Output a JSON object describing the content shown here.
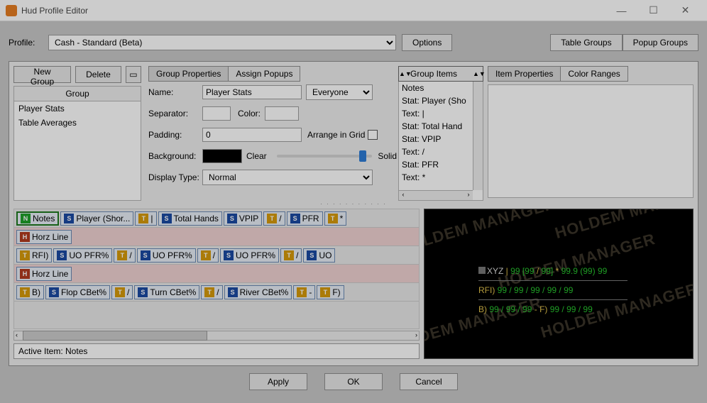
{
  "window": {
    "title": "Hud Profile Editor"
  },
  "profile": {
    "label": "Profile:",
    "value": "Cash - Standard (Beta)",
    "options_btn": "Options",
    "table_groups": "Table Groups",
    "popup_groups": "Popup Groups"
  },
  "groups": {
    "new_btn": "New Group",
    "delete_btn": "Delete",
    "header": "Group",
    "items": [
      "Player Stats",
      "Table Averages"
    ]
  },
  "props_tabs": {
    "group_properties": "Group Properties",
    "assign_popups": "Assign Popups"
  },
  "form": {
    "name_lbl": "Name:",
    "name_val": "Player Stats",
    "everyone": "Everyone",
    "sep_lbl": "Separator:",
    "color_lbl": "Color:",
    "pad_lbl": "Padding:",
    "pad_val": "0",
    "arrange": "Arrange in Grid",
    "bg_lbl": "Background:",
    "clear": "Clear",
    "solid": "Solid",
    "disp_lbl": "Display Type:",
    "disp_val": "Normal"
  },
  "group_items": {
    "header": "Group Items",
    "list": [
      "Notes",
      "Stat: Player (Sho",
      "Text: |",
      "Stat: Total Hand",
      "Stat: VPIP",
      "Text: /",
      "Stat: PFR",
      "Text: *"
    ]
  },
  "right_tabs": {
    "item_props": "Item Properties",
    "color_ranges": "Color Ranges"
  },
  "builder": {
    "row1": [
      {
        "t": "N",
        "l": "Notes",
        "sel": true
      },
      {
        "t": "S",
        "l": "Player (Shor..."
      },
      {
        "t": "T",
        "l": "|"
      },
      {
        "t": "S",
        "l": "Total Hands"
      },
      {
        "t": "S",
        "l": "VPIP"
      },
      {
        "t": "T",
        "l": "/"
      },
      {
        "t": "S",
        "l": "PFR"
      },
      {
        "t": "T",
        "l": "*"
      }
    ],
    "row2": [
      {
        "t": "H",
        "l": "Horz Line"
      }
    ],
    "row3": [
      {
        "t": "T",
        "l": "RFI)"
      },
      {
        "t": "S",
        "l": "UO PFR%"
      },
      {
        "t": "T",
        "l": "/"
      },
      {
        "t": "S",
        "l": "UO PFR%"
      },
      {
        "t": "T",
        "l": "/"
      },
      {
        "t": "S",
        "l": "UO PFR%"
      },
      {
        "t": "T",
        "l": "/"
      },
      {
        "t": "S",
        "l": "UO"
      }
    ],
    "row4": [
      {
        "t": "H",
        "l": "Horz Line"
      }
    ],
    "row5": [
      {
        "t": "T",
        "l": "B)"
      },
      {
        "t": "S",
        "l": "Flop CBet%"
      },
      {
        "t": "T",
        "l": "/"
      },
      {
        "t": "S",
        "l": "Turn CBet%"
      },
      {
        "t": "T",
        "l": "/"
      },
      {
        "t": "S",
        "l": "River CBet%"
      },
      {
        "t": "T",
        "l": " - "
      },
      {
        "t": "T",
        "l": "F)"
      }
    ]
  },
  "active_item": {
    "label": "Active Item: Notes"
  },
  "preview": {
    "wm": "HOLDEM MANAGER",
    "l1": {
      "name": "XYZ",
      "sep": " | ",
      "a": "99 ",
      "b": "[99",
      "c": " / ",
      "d": "99]",
      "e": " * ",
      "f": "99.9 ",
      "g": "(99) ",
      "h": "99"
    },
    "l2": {
      "p": "RFI) ",
      "v": "99 / 99 / 99 / 99 / 99"
    },
    "l3": {
      "p": "B) ",
      "v1": "99 / 99 / 99",
      "sep": "  -  ",
      "p2": "F) ",
      "v2": "99 / 99 / 99"
    }
  },
  "buttons": {
    "apply": "Apply",
    "ok": "OK",
    "cancel": "Cancel"
  }
}
